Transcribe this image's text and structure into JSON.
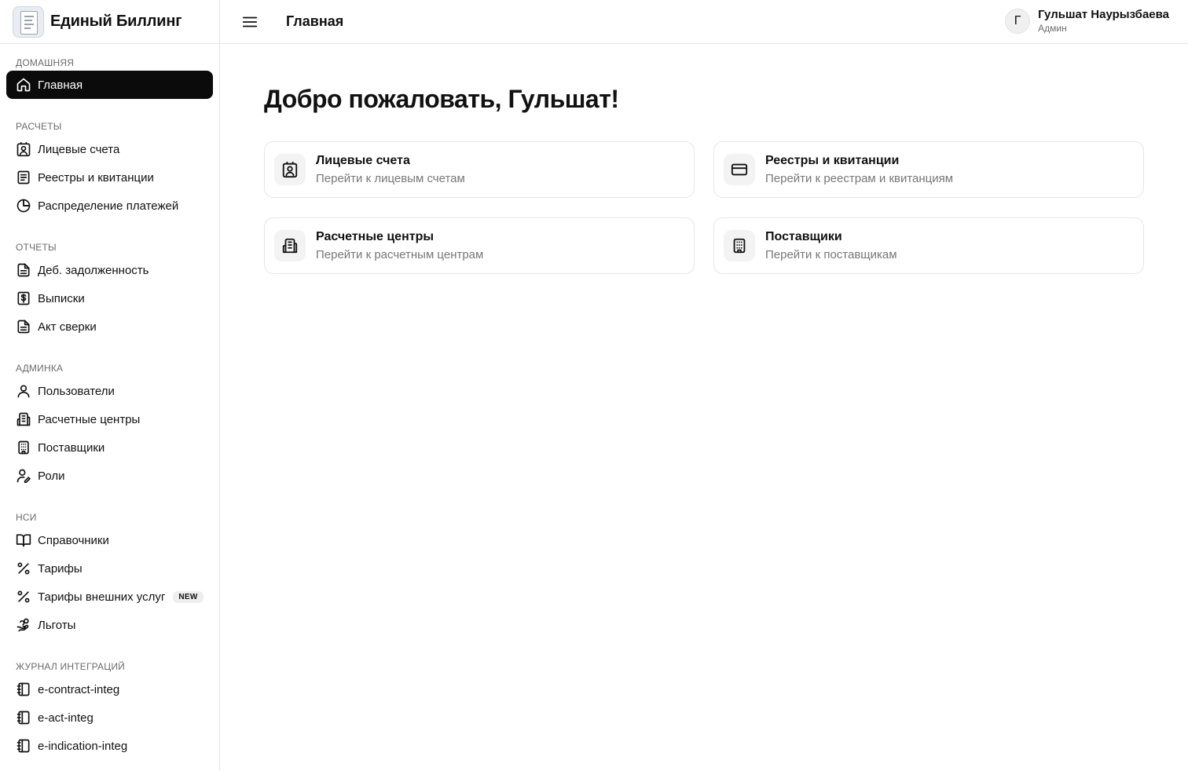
{
  "app": {
    "title": "Единый Биллинг"
  },
  "header": {
    "page_title": "Главная",
    "menu_icon": "hamburger-icon"
  },
  "user": {
    "initial": "Г",
    "name": "Гульшат Наурызбаева",
    "role": "Админ"
  },
  "sidebar": {
    "sections": [
      {
        "label": "ДОМАШНЯЯ",
        "items": [
          {
            "label": "Главная",
            "icon": "home-icon",
            "active": true
          }
        ]
      },
      {
        "label": "РАСЧЕТЫ",
        "items": [
          {
            "label": "Лицевые счета",
            "icon": "contact-icon"
          },
          {
            "label": "Реестры и квитанции",
            "icon": "document-icon"
          },
          {
            "label": "Распределение платежей",
            "icon": "pie-chart-icon"
          }
        ]
      },
      {
        "label": "ОТЧЕТЫ",
        "items": [
          {
            "label": "Деб. задолженность",
            "icon": "file-text-icon"
          },
          {
            "label": "Выписки",
            "icon": "dollar-receipt-icon"
          },
          {
            "label": "Акт сверки",
            "icon": "file-text-icon"
          }
        ]
      },
      {
        "label": "АДМИНКА",
        "items": [
          {
            "label": "Пользователи",
            "icon": "user-icon"
          },
          {
            "label": "Расчетные центры",
            "icon": "buildings-icon"
          },
          {
            "label": "Поставщики",
            "icon": "building-icon"
          },
          {
            "label": "Роли",
            "icon": "user-pen-icon"
          }
        ]
      },
      {
        "label": "НСИ",
        "items": [
          {
            "label": "Справочники",
            "icon": "book-open-icon"
          },
          {
            "label": "Тарифы",
            "icon": "percent-icon"
          },
          {
            "label": "Тарифы внешних услуг",
            "icon": "percent-icon",
            "badge": "NEW"
          },
          {
            "label": "Льготы",
            "icon": "hand-coins-icon"
          }
        ]
      },
      {
        "label": "ЖУРНАЛ ИНТЕГРАЦИЙ",
        "items": [
          {
            "label": "e-contract-integ",
            "icon": "notebook-icon"
          },
          {
            "label": "e-act-integ",
            "icon": "notebook-icon"
          },
          {
            "label": "e-indication-integ",
            "icon": "notebook-icon"
          }
        ]
      }
    ]
  },
  "main": {
    "welcome": "Добро пожаловать, Гульшат!",
    "cards": [
      {
        "title": "Лицевые счета",
        "subtitle": "Перейти к лицевым счетам",
        "icon": "contact-icon"
      },
      {
        "title": "Реестры и квитанции",
        "subtitle": "Перейти к реестрам и квитанциям",
        "icon": "credit-card-icon"
      },
      {
        "title": "Расчетные центры",
        "subtitle": "Перейти к расчетным центрам",
        "icon": "buildings-icon"
      },
      {
        "title": "Поставщики",
        "subtitle": "Перейти к поставщикам",
        "icon": "building-icon"
      }
    ]
  },
  "colors": {
    "active_bg": "#0b0b0b",
    "border": "#e6e6e6",
    "muted": "#777777",
    "badge_bg": "#eeeeee"
  }
}
